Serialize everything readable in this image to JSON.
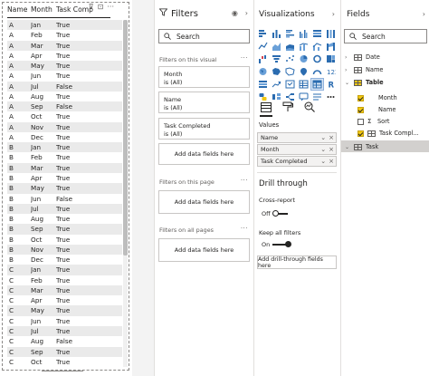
{
  "table": {
    "headers": {
      "name": "Name",
      "month": "Month",
      "task": "Task Comp"
    },
    "rows": [
      [
        "A",
        "Jan",
        "True"
      ],
      [
        "A",
        "Feb",
        "True"
      ],
      [
        "A",
        "Mar",
        "True"
      ],
      [
        "A",
        "Apr",
        "True"
      ],
      [
        "A",
        "May",
        "True"
      ],
      [
        "A",
        "Jun",
        "True"
      ],
      [
        "A",
        "Jul",
        "False"
      ],
      [
        "A",
        "Aug",
        "True"
      ],
      [
        "A",
        "Sep",
        "False"
      ],
      [
        "A",
        "Oct",
        "True"
      ],
      [
        "A",
        "Nov",
        "True"
      ],
      [
        "A",
        "Dec",
        "True"
      ],
      [
        "B",
        "Jan",
        "True"
      ],
      [
        "B",
        "Feb",
        "True"
      ],
      [
        "B",
        "Mar",
        "True"
      ],
      [
        "B",
        "Apr",
        "True"
      ],
      [
        "B",
        "May",
        "True"
      ],
      [
        "B",
        "Jun",
        "False"
      ],
      [
        "B",
        "Jul",
        "True"
      ],
      [
        "B",
        "Aug",
        "True"
      ],
      [
        "B",
        "Sep",
        "True"
      ],
      [
        "B",
        "Oct",
        "True"
      ],
      [
        "B",
        "Nov",
        "True"
      ],
      [
        "B",
        "Dec",
        "True"
      ],
      [
        "C",
        "Jan",
        "True"
      ],
      [
        "C",
        "Feb",
        "True"
      ],
      [
        "C",
        "Mar",
        "True"
      ],
      [
        "C",
        "Apr",
        "True"
      ],
      [
        "C",
        "May",
        "True"
      ],
      [
        "C",
        "Jun",
        "True"
      ],
      [
        "C",
        "Jul",
        "True"
      ],
      [
        "C",
        "Aug",
        "False"
      ],
      [
        "C",
        "Sep",
        "True"
      ],
      [
        "C",
        "Oct",
        "True"
      ]
    ]
  },
  "filters": {
    "title": "Filters",
    "search_placeholder": "Search",
    "on_visual_label": "Filters on this visual",
    "cards": [
      {
        "field": "Month",
        "state": "is (All)"
      },
      {
        "field": "Name",
        "state": "is (All)"
      },
      {
        "field": "Task Completed",
        "state": "is (All)"
      }
    ],
    "add_fields": "Add data fields here",
    "on_page_label": "Filters on this page",
    "on_all_pages_label": "Filters on all pages",
    "dots": "···"
  },
  "visualizations": {
    "title": "Visualizations",
    "values_label": "Values",
    "wells": [
      "Name",
      "Month",
      "Task Completed"
    ],
    "drill_title": "Drill through",
    "cross_report": "Cross-report",
    "cross_state": "Off",
    "keep_filters": "Keep all filters",
    "keep_state": "On",
    "drill_add": "Add drill-through fields here"
  },
  "fields": {
    "title": "Fields",
    "search_placeholder": "Search",
    "tables": [
      "Date",
      "Name",
      "Table",
      "Task"
    ],
    "table_fields": [
      "Month",
      "Name",
      "Sort",
      "Task Compl..."
    ]
  },
  "icons": {
    "search": "search-icon",
    "funnel": "funnel-icon",
    "eye": "eye-icon",
    "chevron": "chevron-right-icon"
  },
  "colors": {
    "accent_yellow": "#f2c811",
    "selection_blue": "#d6e4f5"
  }
}
